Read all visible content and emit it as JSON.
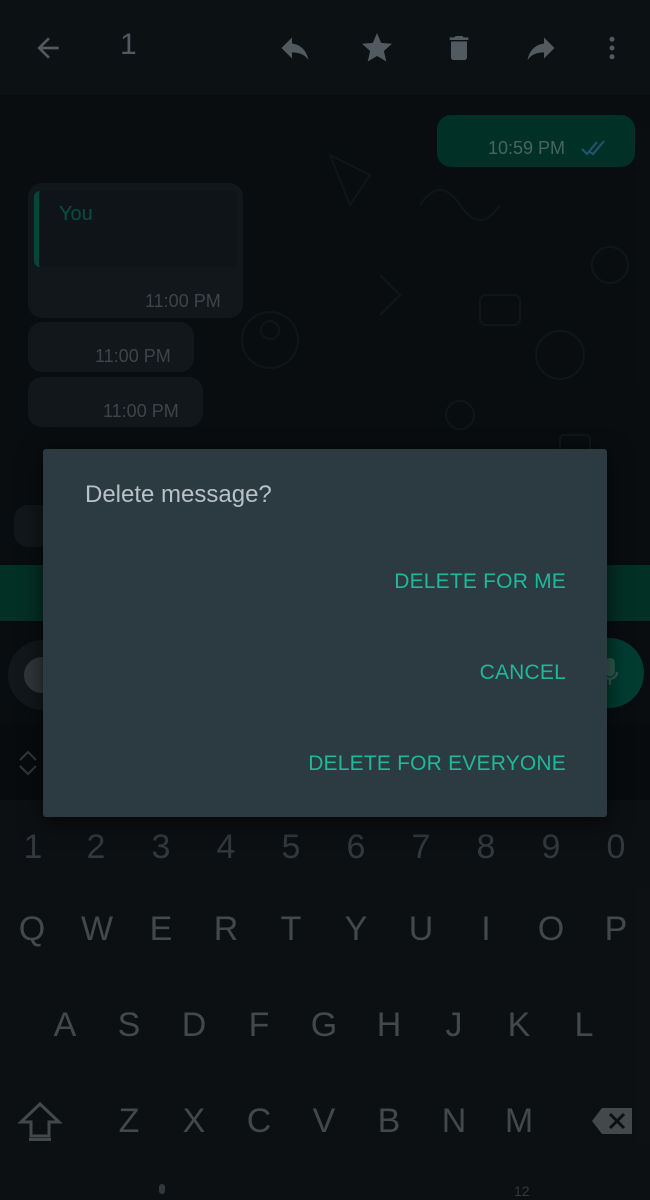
{
  "topbar": {
    "selected_count": "1",
    "icons": [
      "back-arrow-icon",
      "reply-icon",
      "star-icon",
      "delete-icon",
      "forward-icon",
      "more-vert-icon"
    ]
  },
  "chat": {
    "outgoing_time": "10:59 PM",
    "quote_name": "You",
    "incoming_times": [
      "11:00 PM",
      "11:00 PM",
      "11:00 PM"
    ]
  },
  "dialog": {
    "title": "Delete message?",
    "delete_for_me": "DELETE FOR ME",
    "cancel": "CANCEL",
    "delete_for_everyone": "DELETE FOR EVERYONE"
  },
  "keyboard": {
    "numbers": [
      "1",
      "2",
      "3",
      "4",
      "5",
      "6",
      "7",
      "8",
      "9",
      "0"
    ],
    "row1": [
      "Q",
      "W",
      "E",
      "R",
      "T",
      "Y",
      "U",
      "I",
      "O",
      "P"
    ],
    "row2": [
      "A",
      "S",
      "D",
      "F",
      "G",
      "H",
      "J",
      "K",
      "L"
    ],
    "row3": [
      "Z",
      "X",
      "C",
      "V",
      "B",
      "N",
      "M"
    ],
    "footer_mode": "12"
  },
  "colors": {
    "accent": "#20b89a",
    "dialog_bg": "#2c3a42",
    "outgoing_bubble": "#034a3c"
  }
}
